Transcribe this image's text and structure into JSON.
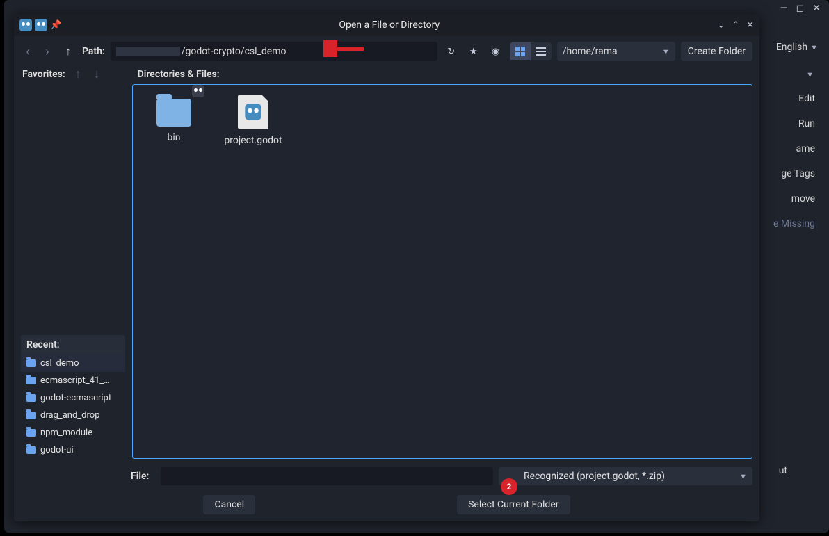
{
  "titlebar": {
    "title": "Open a File or Directory"
  },
  "toolbar": {
    "path_label": "Path:",
    "path_value": "/godot-crypto/csl_demo",
    "drive_value": "/home/rama",
    "create_folder": "Create Folder"
  },
  "headers": {
    "favorites": "Favorites:",
    "dirs_files": "Directories & Files:"
  },
  "recent": {
    "header": "Recent:",
    "items": [
      "csl_demo",
      "ecmascript_41_…",
      "godot-ecmascript",
      "drag_and_drop",
      "npm_module",
      "godot-ui"
    ]
  },
  "files": {
    "items": [
      {
        "name": "bin",
        "type": "folder"
      },
      {
        "name": "project.godot",
        "type": "godot"
      }
    ]
  },
  "file_row": {
    "label": "File:",
    "filter": "Recognized (project.godot, *.zip)"
  },
  "buttons": {
    "cancel": "Cancel",
    "select": "Select Current Folder"
  },
  "bg": {
    "lang": "English",
    "edit": "Edit",
    "run": "Run",
    "rename": "ame",
    "tags": "ge Tags",
    "remove": "move",
    "missing": "e Missing",
    "about": "ut"
  },
  "annotations": {
    "badge2": "2"
  }
}
